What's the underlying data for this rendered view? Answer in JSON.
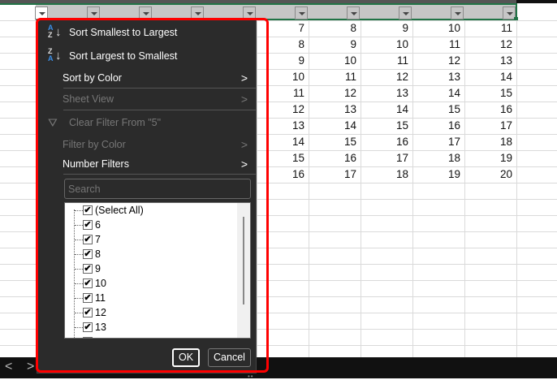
{
  "sheet": {
    "rows": [
      [
        7,
        8,
        9,
        10,
        11
      ],
      [
        8,
        9,
        10,
        11,
        12
      ],
      [
        9,
        10,
        11,
        12,
        13
      ],
      [
        10,
        11,
        12,
        13,
        14
      ],
      [
        11,
        12,
        13,
        14,
        15
      ],
      [
        12,
        13,
        14,
        15,
        16
      ],
      [
        13,
        14,
        15,
        16,
        17
      ],
      [
        14,
        15,
        16,
        17,
        18
      ],
      [
        15,
        16,
        17,
        18,
        19
      ],
      [
        16,
        17,
        18,
        19,
        20
      ]
    ]
  },
  "menu": {
    "sort_asc": "Sort Smallest to Largest",
    "sort_desc": "Sort Largest to Smallest",
    "sort_color": "Sort by Color",
    "sheet_view": "Sheet View",
    "clear_filter": "Clear Filter From \"5\"",
    "filter_color": "Filter by Color",
    "number_filters": "Number Filters",
    "search_placeholder": "Search",
    "list": [
      "(Select All)",
      "6",
      "7",
      "8",
      "9",
      "10",
      "11",
      "12",
      "13"
    ],
    "ok": "OK",
    "cancel": "Cancel"
  },
  "colors": {
    "accent": "#217346",
    "highlight": "#ff0000",
    "menu_bg": "#2b2b2b"
  },
  "bottombar": {
    "prev": "<",
    "next": ">"
  }
}
